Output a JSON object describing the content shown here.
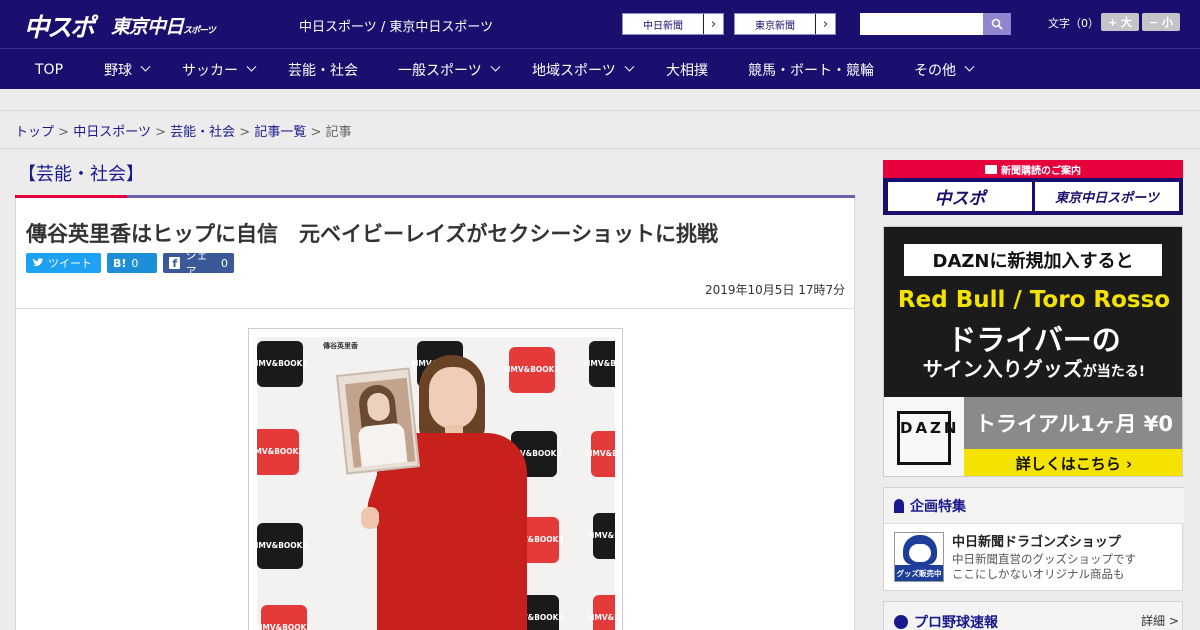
{
  "header": {
    "logo_chuspo": "中スポ",
    "logo_tokyo": "東京中日",
    "logo_tokyo_small": "スポーツ",
    "site_title": "中日スポーツ / 東京中日スポーツ",
    "paper_links": [
      "中日新聞",
      "東京新聞"
    ],
    "search_placeholder": "",
    "font_size_label": "文字（0）",
    "font_bigger": "+ 大",
    "font_smaller": "− 小"
  },
  "nav": {
    "items": [
      "TOP",
      "野球",
      "サッカー",
      "芸能・社会",
      "一般スポーツ",
      "地域スポーツ",
      "大相撲",
      "競馬・ボート・競輪",
      "その他"
    ]
  },
  "breadcrumb": {
    "items": [
      "トップ",
      "中日スポーツ",
      "芸能・社会",
      "記事一覧"
    ],
    "current": "記事",
    "separator": ">"
  },
  "article": {
    "category": "【芸能・社会】",
    "headline": "傳谷英里香はヒップに自信　元ベイビーレイズがセクシーショットに挑戦",
    "share": {
      "tweet": "ツイート",
      "hatena_glyph": "B!",
      "hatena_count": "0",
      "facebook_glyph": "f",
      "facebook_label": "シェア",
      "facebook_count": "0"
    },
    "date": "2019年10月5日 17時7分",
    "photo_board_text": "傳谷英里香",
    "photo_backdrop_text": "HMV & BOOKS"
  },
  "sidebar": {
    "subscribe_head": "新聞購読のご案内",
    "subscribe_buttons": [
      "中スポ",
      "東京中日スポーツ"
    ],
    "ad": {
      "top": "DAZNに新規加入すると",
      "brand": "Red Bull / Toro Rosso",
      "line1": "ドライバーの",
      "line2_main": "サイン入りグッズ",
      "line2_tail": "が当たる!",
      "logo": "DAZN",
      "trial": "トライアル1ヶ月 ¥0",
      "more": "詳しくはこちら ›"
    },
    "feature": {
      "title": "企画特集",
      "thumb_tag": "グッズ販売中",
      "item_title": "中日新聞ドラゴンズショップ",
      "item_desc1": "中日新聞直営のグッズショップです",
      "item_desc2": "ここにしかないオリジナル商品も"
    },
    "baseball": {
      "title": "プロ野球速報",
      "more": "詳細 >"
    }
  },
  "colors": {
    "brand_navy": "#1a0f6e",
    "accent_red": "#e6003c",
    "twitter": "#1da1f2",
    "facebook": "#3b5998",
    "dazn_yellow": "#f4e300"
  }
}
